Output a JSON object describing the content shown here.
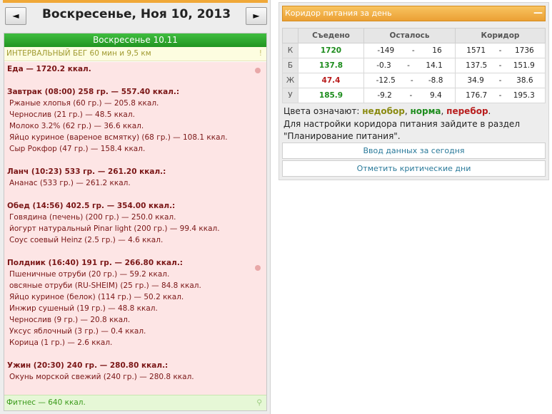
{
  "nav": {
    "prev": "◄",
    "next": "►",
    "date_title": "Воскресенье, Ноя 10, 2013"
  },
  "day": {
    "header": "Воскресенье 10.11",
    "activity": "ИНТЕРВАЛЬНЫЙ БЕГ 60 мин и 9,5 км",
    "activity_mark": "!",
    "food_total": "Еда — 1720.2 ккал.",
    "lines": [
      {
        "type": "head",
        "text": "Завтрак (08:00) 258 гр. — 557.40 ккал.:"
      },
      {
        "type": "item",
        "text": "Ржаные хлопья (60 гр.) — 205.8 ккал."
      },
      {
        "type": "item",
        "text": "Чернослив (21 гр.) — 48.5 ккал."
      },
      {
        "type": "item",
        "text": "Молоко 3.2% (62 гр.) — 36.6 ккал."
      },
      {
        "type": "item",
        "text": "Яйцо куриное (вареное всмятку) (68 гр.) — 108.1 ккал."
      },
      {
        "type": "item",
        "text": "Сыр Рокфор (47 гр.) — 158.4 ккал."
      },
      {
        "type": "blank",
        "text": ""
      },
      {
        "type": "head",
        "text": "Ланч (10:23) 533 гр. — 261.20 ккал.:"
      },
      {
        "type": "item",
        "text": "Ананас (533 гр.) — 261.2 ккал."
      },
      {
        "type": "blank",
        "text": ""
      },
      {
        "type": "head",
        "text": "Обед (14:56) 402.5 гр. — 354.00 ккал.:"
      },
      {
        "type": "item",
        "text": "Говядина (печень) (200 гр.) — 250.0 ккал."
      },
      {
        "type": "item",
        "text": "йогурт натуральный Pinar light (200 гр.) — 99.4 ккал."
      },
      {
        "type": "item",
        "text": "Соус соевый Heinz (2.5 гр.) — 4.6 ккал."
      },
      {
        "type": "blank",
        "text": ""
      },
      {
        "type": "head",
        "text": "Полдник (16:40) 191 гр. — 266.80 ккал.:"
      },
      {
        "type": "item",
        "text": "Пшеничные отруби (20 гр.) — 59.2 ккал."
      },
      {
        "type": "item",
        "text": "овсяные отруби (RU-SHEIM) (25 гр.) — 84.8 ккал."
      },
      {
        "type": "item",
        "text": "Яйцо куриное (белок) (114 гр.) — 50.2 ккал."
      },
      {
        "type": "item",
        "text": "Инжир сушеный (19 гр.) — 48.8 ккал."
      },
      {
        "type": "item",
        "text": "Чернослив (9 гр.) — 20.8 ккал."
      },
      {
        "type": "item",
        "text": "Уксус яблочный (3 гр.) — 0.4 ккал."
      },
      {
        "type": "item",
        "text": "Корица (1 гр.) — 2.6 ккал."
      },
      {
        "type": "blank",
        "text": ""
      },
      {
        "type": "head",
        "text": "Ужин (20:30) 240 гр. — 280.80 ккал.:"
      },
      {
        "type": "item",
        "text": "Окунь морской свежий (240 гр.) — 280.8 ккал."
      }
    ],
    "fitness": "Фитнес — 640 ккал."
  },
  "corridor": {
    "title": "Коридор питания за день",
    "collapse": "—",
    "headers": [
      "",
      "Съедено",
      "Осталось",
      "Коридор"
    ],
    "rows": [
      {
        "label": "К",
        "eaten": "1720",
        "eaten_color": "#1c8c1c",
        "left_min": "-149",
        "left_max": "16",
        "corr_min": "1571",
        "corr_max": "1736"
      },
      {
        "label": "Б",
        "eaten": "137.8",
        "eaten_color": "#1c8c1c",
        "left_min": "-0.3",
        "left_max": "14.1",
        "corr_min": "137.5",
        "corr_max": "151.9"
      },
      {
        "label": "Ж",
        "eaten": "47.4",
        "eaten_color": "#b81c1c",
        "left_min": "-12.5",
        "left_max": "-8.8",
        "corr_min": "34.9",
        "corr_max": "38.6"
      },
      {
        "label": "У",
        "eaten": "185.9",
        "eaten_color": "#1c8c1c",
        "left_min": "-9.2",
        "left_max": "9.4",
        "corr_min": "176.7",
        "corr_max": "195.3"
      }
    ],
    "dash": "-",
    "legend_prefix": "Цвета означают:",
    "legend_under": "недобор",
    "legend_norm": "норма",
    "legend_over": "перебор",
    "note": "Для настройки коридора питания зайдите в раздел \"Планирование питания\".",
    "btn_enter": "Ввод данных за сегодня",
    "btn_critical": "Отметить критические дни"
  }
}
